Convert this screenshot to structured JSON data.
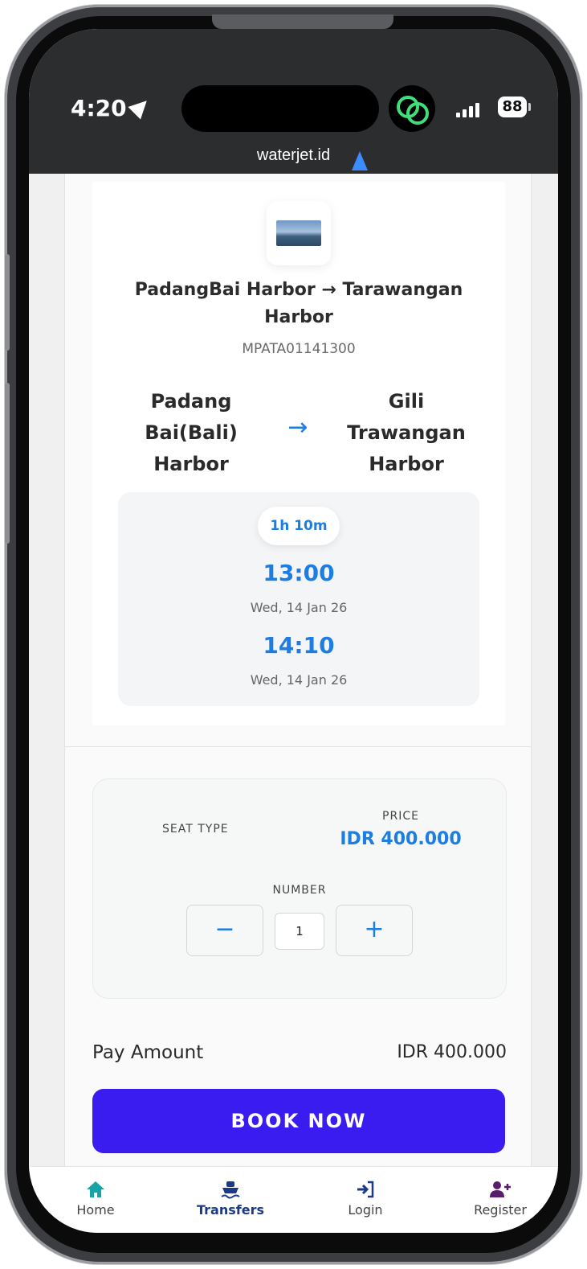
{
  "status_bar": {
    "time": "4:20",
    "battery": "88",
    "url": "waterjet.id"
  },
  "trip": {
    "route_title": "PadangBai Harbor → Tarawangan Harbor",
    "route_code": "MPATA01141300",
    "from_port": "Padang Bai(Bali) Harbor",
    "to_port": "Gili Trawangan Harbor",
    "arrow": "→",
    "duration": "1h 10m",
    "departure_time": "13:00",
    "departure_date": "Wed, 14 Jan 26",
    "arrival_time": "14:10",
    "arrival_date": "Wed, 14 Jan 26"
  },
  "seat": {
    "seat_type_label": "SEAT TYPE",
    "price_label": "PRICE",
    "price_value": "IDR 400.000",
    "number_label": "NUMBER",
    "decrement": "−",
    "quantity": "1",
    "increment": "+"
  },
  "payment": {
    "pay_label": "Pay Amount",
    "pay_value": "IDR 400.000",
    "book_button": "BOOK NOW"
  },
  "bottom_nav": {
    "items": [
      {
        "label": "Home",
        "icon": "home-icon"
      },
      {
        "label": "Transfers",
        "icon": "ferry-icon",
        "active": true
      },
      {
        "label": "Login",
        "icon": "login-icon"
      },
      {
        "label": "Register",
        "icon": "add-user-icon"
      }
    ]
  },
  "colors": {
    "accent_blue": "#1c7de3",
    "book_button": "#3b1cf0",
    "nav_active": "#1b3a8a",
    "home_icon": "#1aa3a3"
  }
}
